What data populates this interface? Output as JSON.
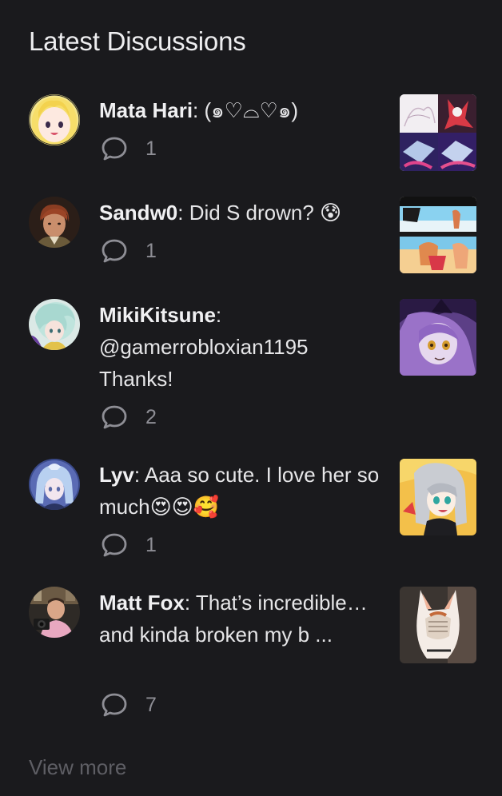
{
  "section": {
    "title": "Latest Discussions",
    "view_more_label": "View more"
  },
  "discussions": [
    {
      "author": "Mata Hari",
      "separator": ": ",
      "message": "(๑♡⌓♡๑)",
      "comment_count": "1",
      "avatar_icon": "anime-blonde-girl-avatar",
      "thumbnail_icon": "manga-collage-thumbnail"
    },
    {
      "author": "Sandw0",
      "separator": ": ",
      "message": "Did S drown? 😰",
      "comment_count": "1",
      "avatar_icon": "brown-hair-man-avatar",
      "thumbnail_icon": "beach-scene-thumbnail"
    },
    {
      "author": "MikiKitsune",
      "separator": ": ",
      "message": "@gamerrobloxian1195 Thanks!",
      "comment_count": "2",
      "avatar_icon": "mint-hair-girl-avatar",
      "thumbnail_icon": "purple-witch-thumbnail"
    },
    {
      "author": "Lyv",
      "separator": ": ",
      "message": "Aaa so cute. I love her so much😍😍🥰",
      "comment_count": "1",
      "avatar_icon": "blue-hair-girl-avatar",
      "thumbnail_icon": "silver-hair-girl-thumbnail"
    },
    {
      "author": "Matt Fox",
      "separator": ": ",
      "message": "That’s incredible… and kinda broken my b ...",
      "comment_count": "7",
      "avatar_icon": "man-with-camera-avatar",
      "thumbnail_icon": "cat-with-mask-thumbnail"
    }
  ],
  "colors": {
    "background": "#1a1a1d",
    "text": "#e6e6e8",
    "muted": "#8e8e95",
    "view_more": "#5e5e64"
  }
}
